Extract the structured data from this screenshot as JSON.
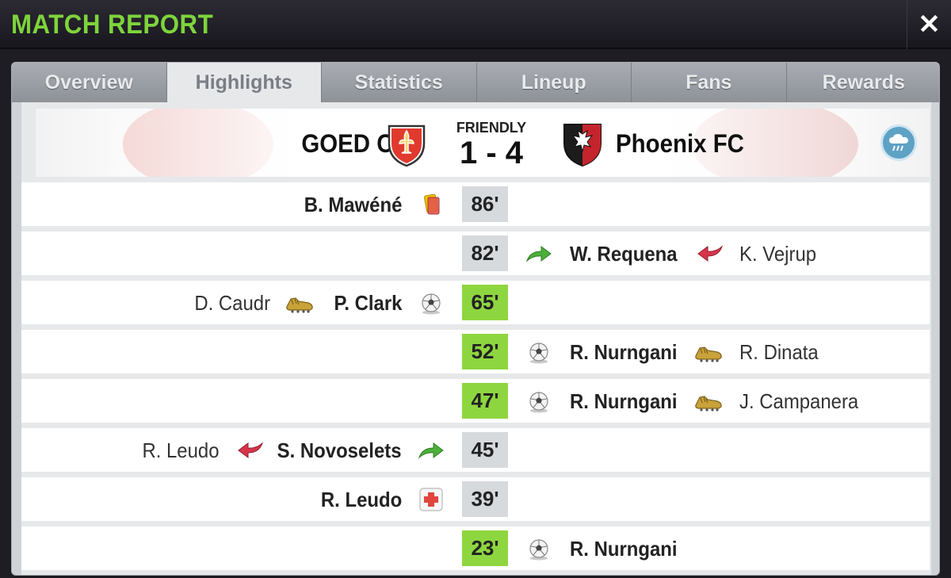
{
  "header": {
    "title": "MATCH REPORT",
    "close_icon": "close-icon"
  },
  "tabs": [
    {
      "label": "Overview",
      "active": false
    },
    {
      "label": "Highlights",
      "active": true
    },
    {
      "label": "Statistics",
      "active": false
    },
    {
      "label": "Lineup",
      "active": false
    },
    {
      "label": "Fans",
      "active": false
    },
    {
      "label": "Rewards",
      "active": false
    }
  ],
  "match": {
    "home_team": "GOED C.F",
    "away_team": "Phoenix FC",
    "match_type": "FRIENDLY",
    "score": "1 - 4",
    "weather_icon": "rain-cloud-icon"
  },
  "events": [
    {
      "minute": "86'",
      "goal": false,
      "home_main": "B. Mawéné",
      "home_icon": "yellow-card-icon"
    },
    {
      "minute": "82'",
      "goal": false,
      "away_in": "W. Requena",
      "away_out": "K. Vejrup"
    },
    {
      "minute": "65'",
      "goal": true,
      "home_main": "P. Clark",
      "home_assist": "D. Caudr"
    },
    {
      "minute": "52'",
      "goal": true,
      "away_main": "R. Nurngani",
      "away_assist": "R. Dinata"
    },
    {
      "minute": "47'",
      "goal": true,
      "away_main": "R. Nurngani",
      "away_assist": "J. Campanera"
    },
    {
      "minute": "45'",
      "goal": false,
      "home_in": "S. Novoselets",
      "home_out": "R. Leudo"
    },
    {
      "minute": "39'",
      "goal": false,
      "home_main": "R. Leudo",
      "home_icon": "injury-icon"
    },
    {
      "minute": "23'",
      "goal": true,
      "away_main": "R. Nurngani"
    }
  ],
  "colors": {
    "title_green": "#7ed43c",
    "goal_minute": "#8ed640",
    "minute_default": "#d7dadd",
    "sub_in_arrow": "#4caf3a",
    "sub_out_arrow": "#d8354a"
  }
}
